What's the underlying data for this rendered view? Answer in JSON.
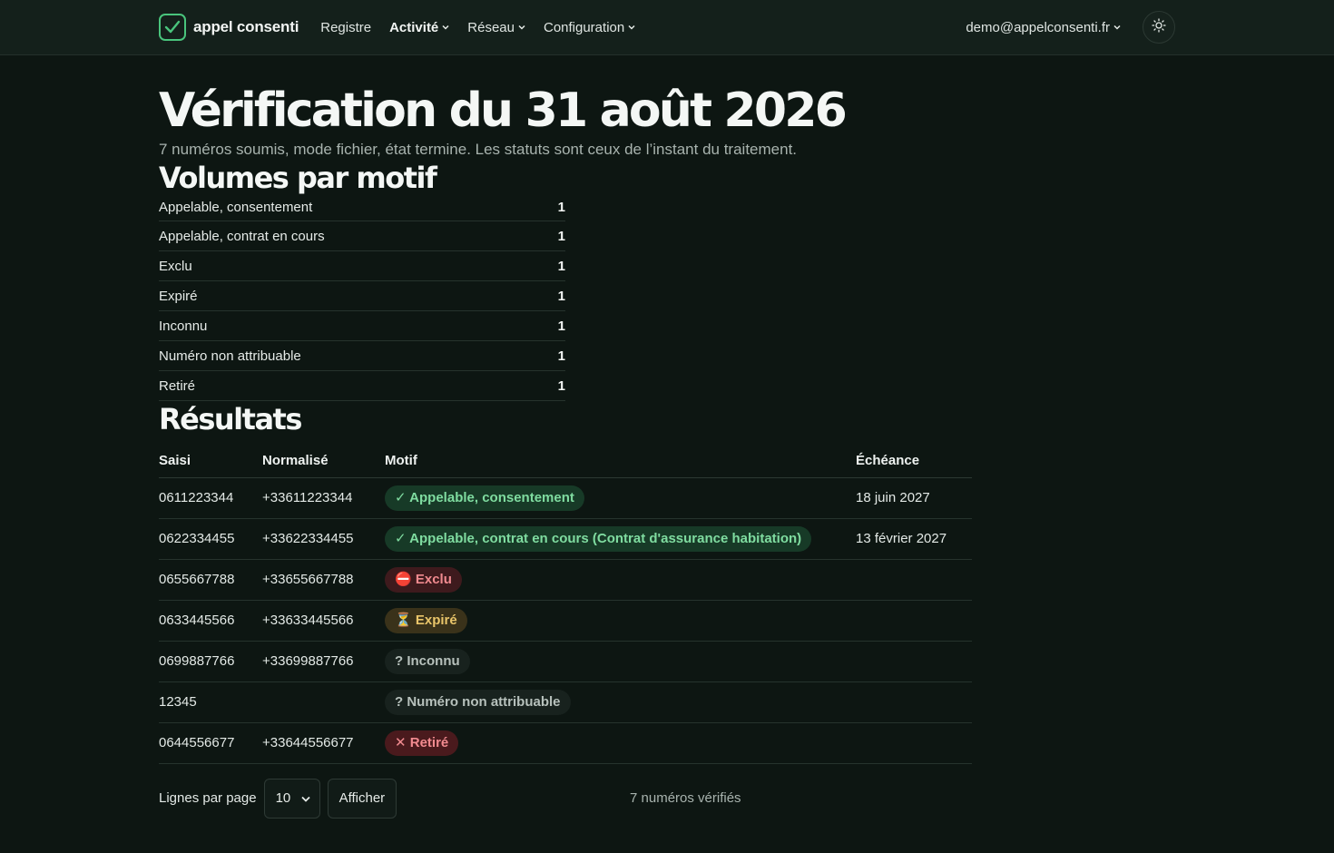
{
  "nav": {
    "brand": "appel consenti",
    "items": [
      {
        "label": "Registre",
        "dropdown": false,
        "active": false
      },
      {
        "label": "Activité",
        "dropdown": true,
        "active": true
      },
      {
        "label": "Réseau",
        "dropdown": true,
        "active": false
      },
      {
        "label": "Configuration",
        "dropdown": true,
        "active": false
      }
    ],
    "user": "demo@appelconsenti.fr",
    "theme_icon": "sun-icon"
  },
  "page": {
    "title": "Vérification du 31 août 2026",
    "subtitle": "7 numéros soumis, mode fichier, état termine. Les statuts sont ceux de l’instant du traitement."
  },
  "volumes": {
    "heading": "Volumes par motif",
    "rows": [
      {
        "label": "Appelable, consentement",
        "count": "1"
      },
      {
        "label": "Appelable, contrat en cours",
        "count": "1"
      },
      {
        "label": "Exclu",
        "count": "1"
      },
      {
        "label": "Expiré",
        "count": "1"
      },
      {
        "label": "Inconnu",
        "count": "1"
      },
      {
        "label": "Numéro non attribuable",
        "count": "1"
      },
      {
        "label": "Retiré",
        "count": "1"
      }
    ]
  },
  "results": {
    "heading": "Résultats",
    "columns": {
      "saisi": "Saisi",
      "normalise": "Normalisé",
      "motif": "Motif",
      "echeance": "Échéance"
    },
    "rows": [
      {
        "saisi": "0611223344",
        "normalise": "+33611223344",
        "motif": "✓ Appelable, consentement",
        "kind": "ok",
        "echeance": "18 juin 2027"
      },
      {
        "saisi": "0622334455",
        "normalise": "+33622334455",
        "motif": "✓ Appelable, contrat en cours (Contrat d'assurance habitation)",
        "kind": "ok",
        "echeance": "13 février 2027"
      },
      {
        "saisi": "0655667788",
        "normalise": "+33655667788",
        "motif": "⛔ Exclu",
        "kind": "excl",
        "echeance": ""
      },
      {
        "saisi": "0633445566",
        "normalise": "+33633445566",
        "motif": "⏳ Expiré",
        "kind": "exp",
        "echeance": ""
      },
      {
        "saisi": "0699887766",
        "normalise": "+33699887766",
        "motif": "? Inconnu",
        "kind": "unk",
        "echeance": ""
      },
      {
        "saisi": "12345",
        "normalise": "",
        "motif": "? Numéro non attribuable",
        "kind": "unk",
        "echeance": ""
      },
      {
        "saisi": "0644556677",
        "normalise": "+33644556677",
        "motif": "✕ Retiré",
        "kind": "ret",
        "echeance": ""
      }
    ]
  },
  "pagination": {
    "rows_label": "Lignes par page",
    "rows_value": "10",
    "show_button": "Afficher",
    "total": "7 numéros vérifiés"
  },
  "colors": {
    "background": "#0d1612",
    "navbar": "#14201b",
    "accent": "#49c47c"
  }
}
